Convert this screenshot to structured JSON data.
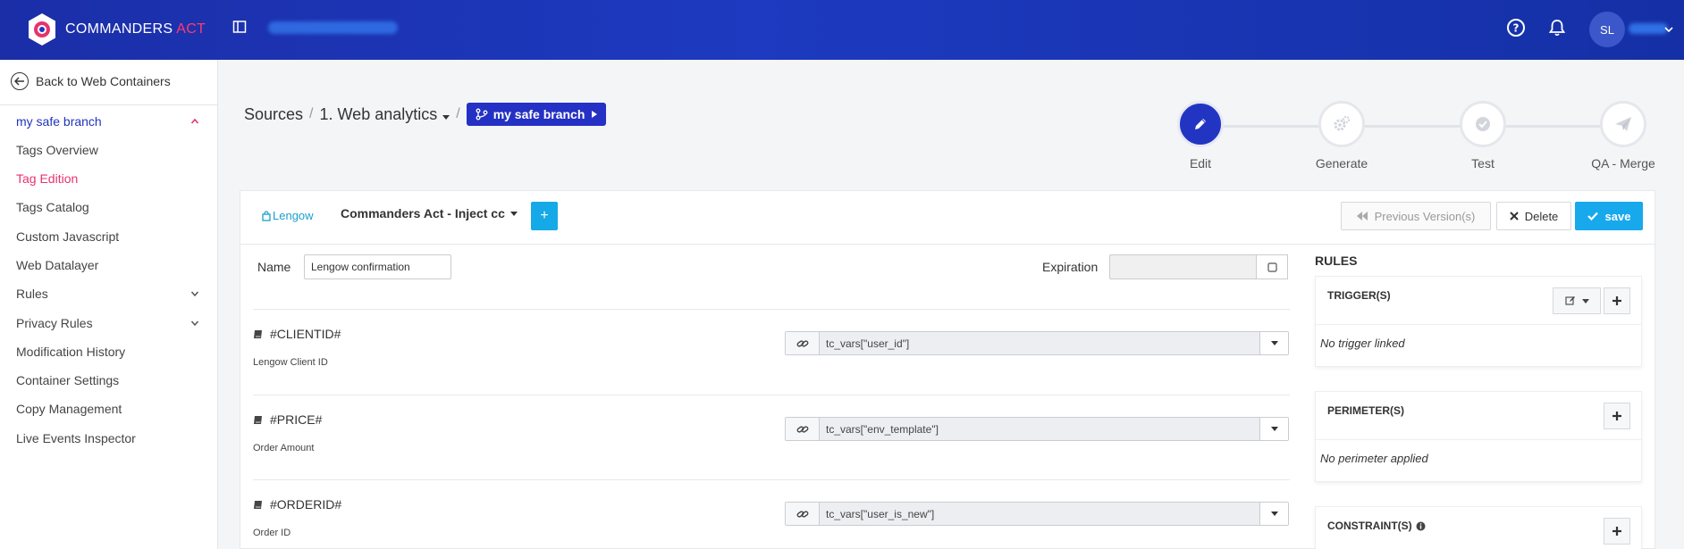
{
  "brand": {
    "name_main": "COMMANDERS",
    "name_accent": "ACT",
    "accent_color": "#ff3a6e",
    "bar_color": "#1b2ea8"
  },
  "user": {
    "initials": "SL"
  },
  "sidebar": {
    "back_label": "Back to Web Containers",
    "branch": "my safe branch",
    "items": [
      {
        "label": "Tags Overview"
      },
      {
        "label": "Tag Edition"
      },
      {
        "label": "Tags Catalog"
      },
      {
        "label": "Custom Javascript"
      },
      {
        "label": "Web Datalayer"
      },
      {
        "label": "Rules"
      },
      {
        "label": "Privacy Rules"
      },
      {
        "label": "Modification History"
      },
      {
        "label": "Container Settings"
      },
      {
        "label": "Copy Management"
      },
      {
        "label": "Live Events Inspector"
      }
    ]
  },
  "breadcrumb": {
    "root": "Sources",
    "container": "1. Web analytics",
    "branch": "my safe branch"
  },
  "steps": [
    {
      "label": "Edit"
    },
    {
      "label": "Generate"
    },
    {
      "label": "Test"
    },
    {
      "label": "QA - Merge"
    }
  ],
  "tag": {
    "logo_text": "Lengow",
    "template": "Commanders Act - Inject cc",
    "prev_versions": "Previous Version(s)",
    "delete": "Delete",
    "save": "save",
    "name_label": "Name",
    "name_value": "Lengow confirmation",
    "expiration_label": "Expiration"
  },
  "variables": [
    {
      "name": "#CLIENTID#",
      "desc": "Lengow Client ID",
      "value": "tc_vars[\"user_id\"]"
    },
    {
      "name": "#PRICE#",
      "desc": "Order Amount",
      "value": "tc_vars[\"env_template\"]"
    },
    {
      "name": "#ORDERID#",
      "desc": "Order ID",
      "value": "tc_vars[\"user_is_new\"]"
    }
  ],
  "rules": {
    "title": "RULES",
    "triggers_title": "TRIGGER(S)",
    "triggers_empty": "No trigger linked",
    "perimeters_title": "PERIMETER(S)",
    "perimeters_empty": "No perimeter applied",
    "constraints_title": "CONSTRAINT(S)"
  }
}
